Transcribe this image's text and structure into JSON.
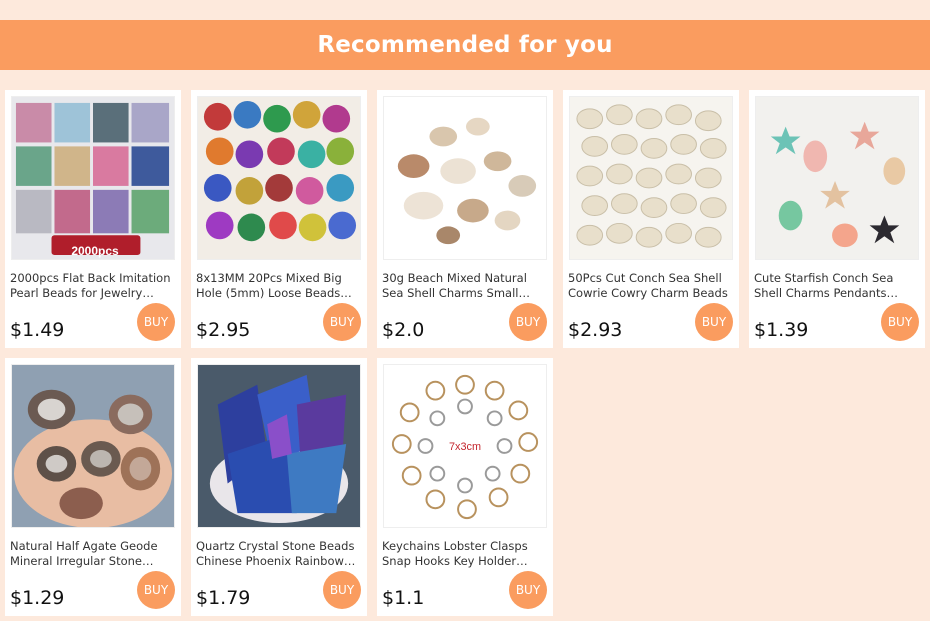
{
  "header": {
    "title": "Recommended for you"
  },
  "buy_label": "BUY",
  "colors": {
    "accent": "#fa9c5f",
    "background": "#fde9dc"
  },
  "products": [
    {
      "title": "2000pcs Flat Back Imitation Pearl Beads for Jewelry Making",
      "price": "$1.49",
      "image_caption": "2000pcs"
    },
    {
      "title": "8x13MM 20Pcs Mixed Big Hole (5mm) Loose Beads Murano Glass",
      "price": "$2.95"
    },
    {
      "title": "30g Beach Mixed Natural Sea Shell Charms Small Seashells",
      "price": "$2.0"
    },
    {
      "title": "50Pcs Cut Conch Sea Shell Cowrie Cowry Charm Beads",
      "price": "$2.93"
    },
    {
      "title": "Cute Starfish Conch Sea Shell Charms Pendants Enamel",
      "price": "$1.39"
    },
    {
      "title": "Natural Half Agate Geode Mineral Irregular Stone Specimen",
      "price": "$1.29"
    },
    {
      "title": "Quartz Crystal Stone Beads Chinese Phoenix Rainbow Titanium",
      "price": "$1.79"
    },
    {
      "title": "Keychains Lobster Clasps Snap Hooks Key Holder Rings",
      "price": "$1.1",
      "image_caption": "7x3cm"
    }
  ]
}
